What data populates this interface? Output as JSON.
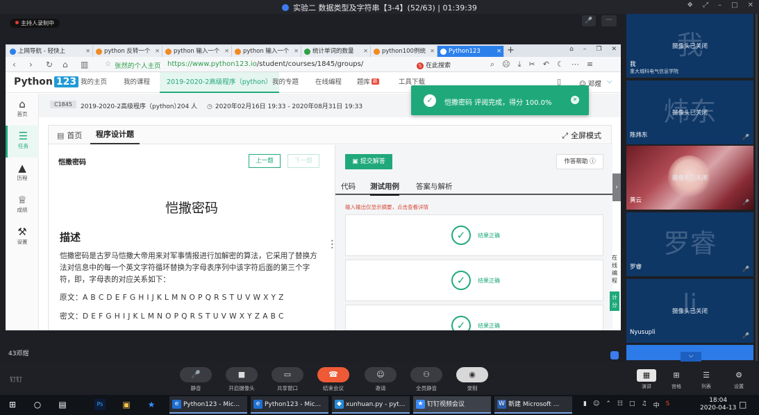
{
  "meeting": {
    "title": "实验二 数据类型及字符串【3-4】(52/63) | 01:39:39",
    "recording_badge": "主持人录制中",
    "presenter_name": "43邓煜",
    "app_logo": "钉钉"
  },
  "browser": {
    "tabs": [
      {
        "label": "上网导航 - 轻快上",
        "icon_color": "#2c80ec"
      },
      {
        "label": "python 反转一个",
        "icon_color": "#f08a24"
      },
      {
        "label": "python 输入一个",
        "icon_color": "#f08a24"
      },
      {
        "label": "python 输入一个",
        "icon_color": "#f08a24"
      },
      {
        "label": "统计单词的数量",
        "icon_color": "#2ea043"
      },
      {
        "label": "python100例统",
        "icon_color": "#f08a24"
      },
      {
        "label": "Python123",
        "icon_color": "#ffffff"
      }
    ],
    "home_label": "张然的个人主页",
    "url_host": "https://www.python123.io",
    "url_path": "/student/courses/1845/groups/",
    "search_placeholder": "在此搜索"
  },
  "site": {
    "logo_text": "Python",
    "logo_num": "123",
    "nav": [
      "我的主页",
      "我的课程",
      "2019-2020-2高级程序（python）",
      "我的专题",
      "在线编程",
      "题库",
      "工具下载"
    ],
    "hot_badge": "新",
    "user": "邓煜"
  },
  "sidebar": [
    {
      "label": "首页",
      "icon": "home-icon"
    },
    {
      "label": "任务",
      "icon": "task-icon"
    },
    {
      "label": "历程",
      "icon": "tree-icon"
    },
    {
      "label": "成绩",
      "icon": "trophy-icon"
    },
    {
      "label": "设置",
      "icon": "wrench-icon"
    }
  ],
  "course": {
    "code": "C1845",
    "name": "2019-2020-2高级程序（python）",
    "count": "204 人",
    "date_range": "2020年02月16日 19:33 - 2020年08月31日 19:33"
  },
  "card": {
    "tab_home": "首页",
    "tab_prog": "程序设计题",
    "fullscreen": "全屏模式"
  },
  "problem": {
    "title_small": "恺撒密码",
    "prev": "上一题",
    "next": "下一题",
    "title_big": "恺撒密码",
    "desc_heading": "描述",
    "desc": "恺撒密码是古罗马恺撒大帝用来对军事情报进行加解密的算法，它采用了替换方法对信息中的每一个英文字符循环替换为字母表序列中该字符后面的第三个字符，即，字母表的对应关系如下：",
    "plain": "原文：A B C D E F G H I J K L M N O P Q R S T U V W X Y Z",
    "cipher": "密文：D E F G H I J K L M N O P Q R S T U V W X Y Z A B C"
  },
  "editor": {
    "submit": "提交解答",
    "help": "作答帮助",
    "tabs": [
      "代码",
      "测试用例",
      "答案与解析"
    ],
    "io_hint": "输入输出仅显示摘要，点击查看详情",
    "results": [
      "结果正确",
      "结果正确",
      "结果正确"
    ],
    "side_online": "在线编程",
    "side_score": "计分"
  },
  "toast": {
    "message": "恺撒密码 评阅完成，得分 100.0%"
  },
  "participants": [
    {
      "big": "我",
      "cam": "摄像头已关闭",
      "name": "我",
      "sub": "重大城科电气信息学院"
    },
    {
      "big": "炜东",
      "cam": "摄像头已关闭",
      "name": "陈炜东",
      "sub": ""
    },
    {
      "big": "",
      "cam": "摄像头已关闭",
      "name": "黄云",
      "sub": ""
    },
    {
      "big": "罗睿",
      "cam": "",
      "name": "罗睿",
      "sub": ""
    },
    {
      "big": "li",
      "cam": "摄像头已关闭",
      "name": "Nyusupli",
      "sub": ""
    }
  ],
  "controls": [
    {
      "label": "静音",
      "icon": "mic-icon"
    },
    {
      "label": "开启摄像头",
      "icon": "camera-icon"
    },
    {
      "label": "共享窗口",
      "icon": "screen-share-icon"
    },
    {
      "label": "结束会议",
      "icon": "hangup-icon"
    },
    {
      "label": "邀请",
      "icon": "invite-icon"
    },
    {
      "label": "全员静音",
      "icon": "mute-all-icon"
    },
    {
      "label": "录制",
      "icon": "record-icon"
    }
  ],
  "view_buttons": [
    {
      "label": "演讲",
      "icon": "speaker-view-icon"
    },
    {
      "label": "宫格",
      "icon": "grid-view-icon"
    },
    {
      "label": "列表",
      "icon": "list-view-icon"
    },
    {
      "label": "设置",
      "icon": "settings-icon"
    }
  ],
  "taskbar": {
    "apps": [
      {
        "label": "Python123 - Mic...",
        "icon_color": "#1f6fd1",
        "glyph": "e"
      },
      {
        "label": "Python123 - Mic...",
        "icon_color": "#1f6fd1",
        "glyph": "e"
      },
      {
        "label": "xunhuan.py - pyt...",
        "icon_color": "#2a8ad4",
        "glyph": "<>"
      },
      {
        "label": "钉钉视频会议",
        "icon_color": "#3a8bff",
        "glyph": "D"
      },
      {
        "label": "新建 Microsoft ...",
        "icon_color": "#2b5caa",
        "glyph": "W"
      }
    ],
    "time": "18:04",
    "date": "2020-04-13",
    "lang": "中"
  }
}
